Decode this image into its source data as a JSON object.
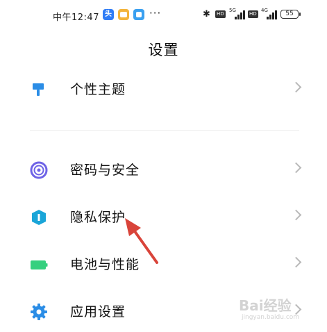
{
  "status_bar": {
    "time": "中午12:47",
    "notifications": [
      {
        "icon": "toutiao-app-icon",
        "glyph": "头"
      },
      {
        "icon": "chat-app-icon",
        "glyph": ""
      },
      {
        "icon": "message-app-icon",
        "glyph": ""
      }
    ],
    "more": "···",
    "bluetooth": "✱",
    "sim1": {
      "hd": "HD",
      "network": "5G"
    },
    "sim2": {
      "hd": "HD",
      "network": "4G"
    },
    "battery": "55"
  },
  "header": {
    "title": "设置"
  },
  "settings": {
    "items": [
      {
        "label": "个性主题",
        "icon": "paint-brush-icon",
        "color": "#2b8de6"
      },
      {
        "label": "密码与安全",
        "icon": "fingerprint-icon",
        "color": "#6e63e6"
      },
      {
        "label": "隐私保护",
        "icon": "privacy-shield-icon",
        "color": "#1aa5d8"
      },
      {
        "label": "电池与性能",
        "icon": "battery-icon",
        "color": "#35d07f"
      },
      {
        "label": "应用设置",
        "icon": "gear-icon",
        "color": "#2b8de6"
      }
    ]
  },
  "annotation": {
    "arrow_color": "#d9443a"
  },
  "watermark": {
    "text": "Bai经验",
    "sub": "jingyan.baidu.com"
  }
}
